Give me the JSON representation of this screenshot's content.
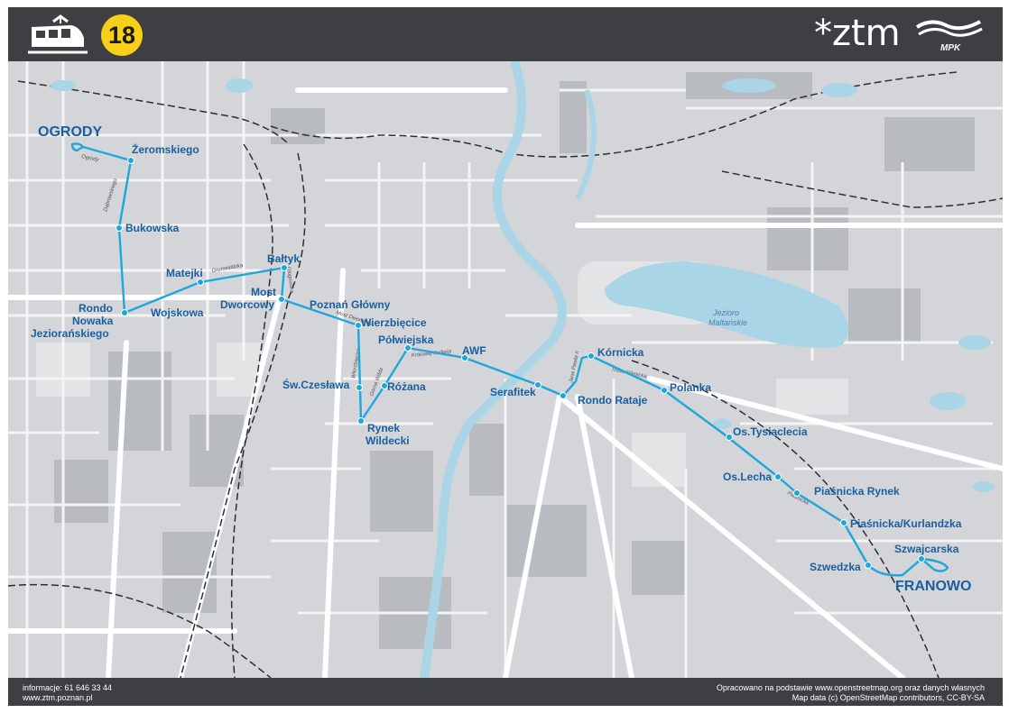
{
  "header": {
    "line_number": "18",
    "operator_logo": "*ztm",
    "carrier_logo": "MPK",
    "icons": [
      "tram-icon"
    ]
  },
  "colors": {
    "route": "#1ea7db",
    "stop_label": "#1a5fa0",
    "badge": "#f7d117",
    "header_bg": "#3d3f42",
    "map_bg": "#d3d5d8",
    "water": "#a9d5e6"
  },
  "terminals": {
    "west": "OGRODY",
    "east": "FRANOWO"
  },
  "stops": [
    "OGRODY",
    "Żeromskiego",
    "Bukowska",
    "Rondo Nowaka Jeziorańskiego",
    "Wojskowa",
    "Matejki",
    "Bałtyk",
    "Most Dworcowy",
    "Poznań Główny",
    "Wierzbięcice",
    "Św.Czesława",
    "Rynek Wildecki",
    "Różana",
    "Półwiejska",
    "AWF",
    "Serafitek",
    "Rondo Rataje",
    "Kórnicka",
    "Polanka",
    "Os.Tysiąclecia",
    "Os.Lecha",
    "Piaśnicka Rynek",
    "Piaśnicka/Kurlandzka",
    "Szwedzka",
    "Szwajcarska",
    "FRANOWO"
  ],
  "labels": {
    "zeromskiego": "Żeromskiego",
    "bukowska": "Bukowska",
    "matejki": "Matejki",
    "baltyk": "Bałtyk",
    "most_1": "Most",
    "most_2": "Dworcowy",
    "rondo_1": "Rondo",
    "rondo_2": "Nowaka",
    "rondo_3": "Jeziorańskiego",
    "wojskowa": "Wojskowa",
    "poznan_glowny": "Poznań Główny",
    "wierzbiecice": "Wierzbięcice",
    "polwiejska": "Półwiejska",
    "awf": "AWF",
    "sw_czeslawa": "Św.Czesława",
    "rozana": "Różana",
    "rynek_1": "Rynek",
    "rynek_2": "Wildecki",
    "serafitek": "Serafitek",
    "rondo_rataje": "Rondo Rataje",
    "kornicka": "Kórnicka",
    "polanka": "Polanka",
    "os_tysiaclecia": "Os.Tysiąclecia",
    "os_lecha": "Os.Lecha",
    "piasnicka_rynek": "Piaśnicka Rynek",
    "piasnicka_kurlandzka": "Piaśnicka/Kurlandzka",
    "szwajcarska": "Szwajcarska",
    "szwedzka": "Szwedzka"
  },
  "streets": {
    "ogrody": "Ogrody",
    "dabrowskiego": "Dąbrowskiego",
    "grunwaldzka": "Grunwaldzka",
    "krolowej_jadwigi": "Królowej Jadwigi",
    "jana_pawla": "Jana Pawła II",
    "trasa_kornicka": "Trasa Kórnicka",
    "piasnicka": "Piaśnicka",
    "wierzbiecice_st": "Wierzbięcice",
    "gorna_wilda": "Górna Wilda",
    "glogowska": "Głogowska",
    "most_dworcowy_st": "Most Dworcowy"
  },
  "lake": {
    "line1": "Jezioro",
    "line2": "Maltańskie"
  },
  "footer": {
    "info_phone": "informacje: 61 646 33 44",
    "website": "www.ztm.poznan.pl",
    "credit_1": "Opracowano na podstawie www.openstreetmap.org oraz danych własnych",
    "credit_2": "Map data (c) OpenStreetMap contributors, CC-BY-SA"
  }
}
